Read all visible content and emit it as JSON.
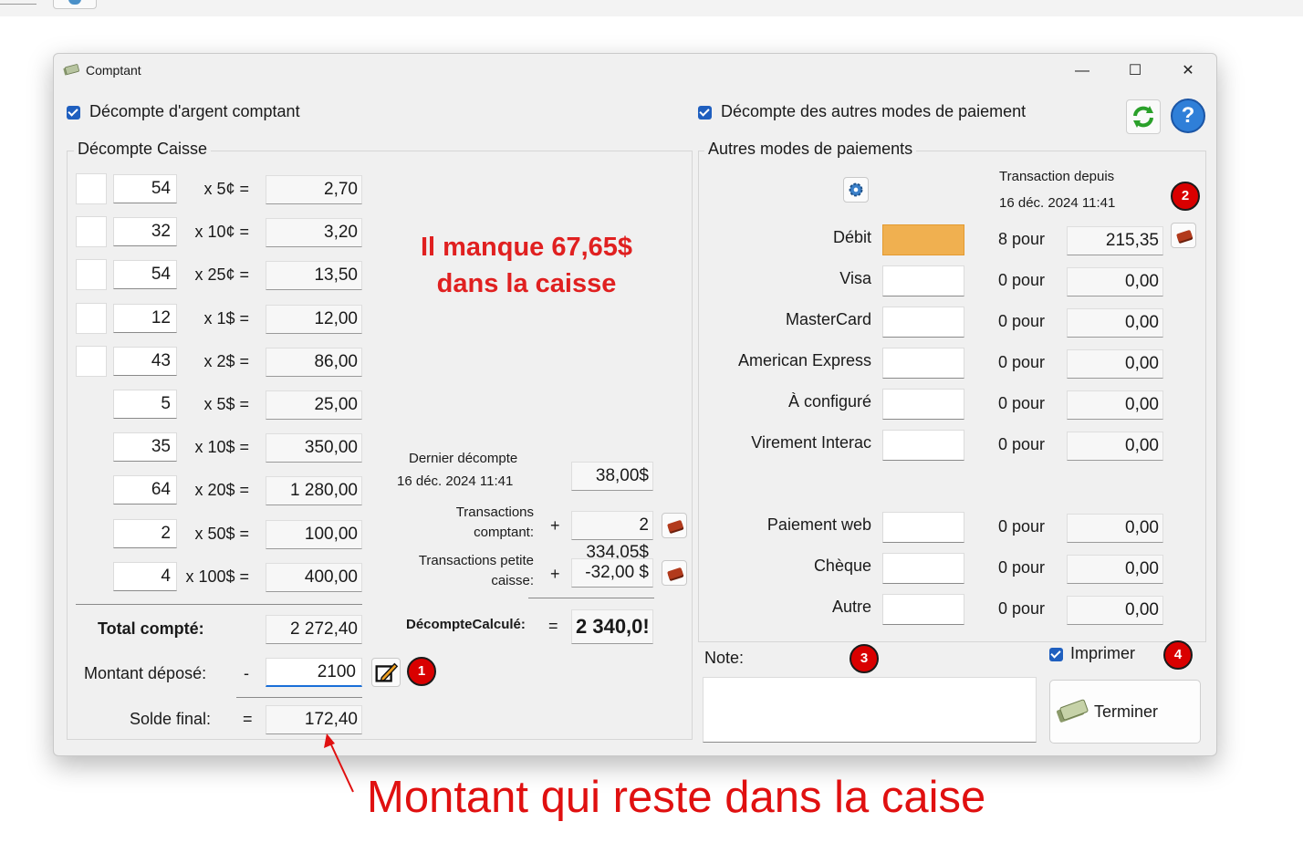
{
  "window": {
    "title": "Comptant",
    "controls": [
      "—",
      "☐",
      "✕"
    ]
  },
  "options": {
    "cash_count_label": "Décompte d'argent comptant",
    "cash_count_checked": true,
    "other_count_label": "Décompte des autres modes de paiement",
    "other_count_checked": true
  },
  "cash": {
    "group_title": "Décompte Caisse",
    "rows": [
      {
        "qty": "54",
        "mult": "x 5¢ =",
        "amount": "2,70",
        "has_roll": true
      },
      {
        "qty": "32",
        "mult": "x 10¢ =",
        "amount": "3,20",
        "has_roll": true
      },
      {
        "qty": "54",
        "mult": "x 25¢ =",
        "amount": "13,50",
        "has_roll": true
      },
      {
        "qty": "12",
        "mult": "x 1$ =",
        "amount": "12,00",
        "has_roll": true
      },
      {
        "qty": "43",
        "mult": "x 2$ =",
        "amount": "86,00",
        "has_roll": true
      },
      {
        "qty": "5",
        "mult": "x 5$ =",
        "amount": "25,00",
        "has_roll": false
      },
      {
        "qty": "35",
        "mult": "x 10$ =",
        "amount": "350,00",
        "has_roll": false
      },
      {
        "qty": "64",
        "mult": "x 20$ =",
        "amount": "1 280,00",
        "has_roll": false
      },
      {
        "qty": "2",
        "mult": "x 50$ =",
        "amount": "100,00",
        "has_roll": false
      },
      {
        "qty": "4",
        "mult": "x 100$ =",
        "amount": "400,00",
        "has_roll": false
      }
    ],
    "total_label": "Total compté:",
    "total_value": "2 272,40",
    "deposit_label": "Montant déposé:",
    "deposit_sign": "-",
    "deposit_value": "2100",
    "final_label": "Solde final:",
    "final_sign": "=",
    "final_value": "172,40"
  },
  "alert": {
    "line1": "Il manque 67,65$",
    "line2": "dans la caisse"
  },
  "summary": {
    "last_count_label": "Dernier décompte",
    "last_count_date": "16 déc. 2024 11:41",
    "last_count_value": "38,00$",
    "cash_tx_label_1": "Transactions",
    "cash_tx_label_2": "comptant:",
    "cash_tx_sign": "+",
    "cash_tx_value": "2 334,05$",
    "petty_label_1": "Transactions petite",
    "petty_label_2": "caisse:",
    "petty_sign": "+",
    "petty_value": "-32,00 $",
    "calc_label": "DécompteCalculé:",
    "calc_sign": "=",
    "calc_value": "2 340,0!"
  },
  "other": {
    "group_title": "Autres modes de paiements",
    "tx_since_label": "Transaction depuis",
    "tx_since_date": "16 déc. 2024 11:41",
    "methods": [
      {
        "name": "Débit",
        "count": "8 pour",
        "amount": "215,35",
        "highlight": true,
        "has_detail": true
      },
      {
        "name": "Visa",
        "count": "0 pour",
        "amount": "0,00",
        "highlight": false,
        "has_detail": false
      },
      {
        "name": "MasterCard",
        "count": "0 pour",
        "amount": "0,00",
        "highlight": false,
        "has_detail": false
      },
      {
        "name": "American Express",
        "count": "0 pour",
        "amount": "0,00",
        "highlight": false,
        "has_detail": false
      },
      {
        "name": "À configuré",
        "count": "0 pour",
        "amount": "0,00",
        "highlight": false,
        "has_detail": false
      },
      {
        "name": "Virement Interac",
        "count": "0 pour",
        "amount": "0,00",
        "highlight": false,
        "has_detail": false
      },
      {
        "name": "Paiement web",
        "count": "0 pour",
        "amount": "0,00",
        "highlight": false,
        "has_detail": false
      },
      {
        "name": "Chèque",
        "count": "0 pour",
        "amount": "0,00",
        "highlight": false,
        "has_detail": false
      },
      {
        "name": "Autre",
        "count": "0 pour",
        "amount": "0,00",
        "highlight": false,
        "has_detail": false
      }
    ]
  },
  "note_label": "Note:",
  "print_label": "Imprimer",
  "print_checked": true,
  "finish_label": "Terminer",
  "badges": [
    "1",
    "2",
    "3",
    "4"
  ],
  "annotation": "Montant qui reste dans la caise",
  "colors": {
    "alert": "#e02020",
    "badge": "#d90000",
    "debit_highlight": "#f0b050",
    "checkbox": "#1f5fbf",
    "deposit_focus": "#1a6fd8"
  },
  "icons": [
    "refresh-icon",
    "help-icon",
    "settings-icon",
    "edit-icon",
    "book-icon",
    "money-icon"
  ]
}
